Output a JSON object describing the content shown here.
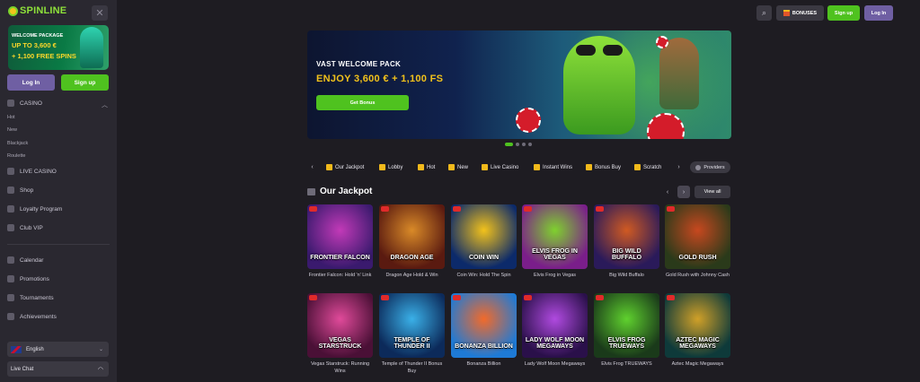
{
  "brand": {
    "logo_text": "SPINLINE"
  },
  "sidebar": {
    "close_icon": "close-icon",
    "promo": {
      "line1": "WELCOME PACKAGE",
      "line2": "UP TO 3,600 €",
      "line3": "+ 1,100 FREE SPINS"
    },
    "login_label": "Log In",
    "signup_label": "Sign up",
    "casino": {
      "label": "CASINO",
      "items": [
        "Hot",
        "New",
        "Blackjack",
        "Roulette"
      ]
    },
    "items": [
      "LIVE CASINO",
      "Shop",
      "Loyalty Program",
      "Club VIP"
    ],
    "items2": [
      "Calendar",
      "Promotions",
      "Tournaments",
      "Achievements"
    ],
    "language": "English",
    "live_chat": "Live Chat"
  },
  "header": {
    "bonuses_label": "BONUSES",
    "signup_label": "Sign up",
    "login_label": "Log In"
  },
  "hero": {
    "title": "VAST WELCOME PACK",
    "subtitle": "ENJOY 3,600 € + 1,100 FS",
    "button": "Get Bonus",
    "slides": 4,
    "active_slide": 1
  },
  "categories": [
    "Our Jackpot",
    "Lobby",
    "Hot",
    "New",
    "Live Casino",
    "Instant Wins",
    "Bonus Buy",
    "Scratch"
  ],
  "providers_label": "Providers",
  "section": {
    "title": "Our Jackpot",
    "view_all": "View all"
  },
  "games": [
    {
      "art": "FRONTIER FALCON",
      "caption": "Frontier Falcon: Hold 'n' Link",
      "c1": "#3a1a6e",
      "c2": "#c23ab8"
    },
    {
      "art": "DRAGON AGE",
      "caption": "Dragon Age Hold & Win",
      "c1": "#5a1a10",
      "c2": "#d98a28"
    },
    {
      "art": "COIN WIN",
      "caption": "Coin Win: Hold The Spin",
      "c1": "#0c2a6a",
      "c2": "#f2c21b"
    },
    {
      "art": "ELVIS FROG IN VEGAS",
      "caption": "Elvis Frog in Vegas",
      "c1": "#7a1e8a",
      "c2": "#7fd12e"
    },
    {
      "art": "BIG WILD BUFFALO",
      "caption": "Big Wild Buffalo",
      "c1": "#2a1a5a",
      "c2": "#d05a22"
    },
    {
      "art": "GOLD RUSH",
      "caption": "Gold Rush with Johnny Cash",
      "c1": "#2a3a1a",
      "c2": "#c7481f"
    },
    {
      "art": "VEGAS STARSTRUCK",
      "caption": "Vegas Starstruck: Running Wins",
      "c1": "#4a1036",
      "c2": "#e04a9a"
    },
    {
      "art": "TEMPLE OF THUNDER II",
      "caption": "Temple of Thunder II Bonus Buy",
      "c1": "#0c2a5a",
      "c2": "#3ab0e8"
    },
    {
      "art": "BONANZA BILLION",
      "caption": "Bonanza Billion",
      "c1": "#1e7ad6",
      "c2": "#f26a2a"
    },
    {
      "art": "LADY WOLF MOON MEGAWAYS",
      "caption": "Lady Wolf Moon Megaways",
      "c1": "#2a104a",
      "c2": "#b04ae0"
    },
    {
      "art": "ELVIS FROG TRUEWAYS",
      "caption": "Elvis Frog TRUEWAYS",
      "c1": "#1a3a1a",
      "c2": "#5fd12e"
    },
    {
      "art": "AZTEC MAGIC MEGAWAYS",
      "caption": "Aztec Magic Megaways",
      "c1": "#0e3a3a",
      "c2": "#d0a028"
    }
  ],
  "colors": {
    "accent_green": "#4fc21f",
    "accent_purple": "#6f5fa3",
    "gold": "#f2c21b",
    "bg": "#1e1c22"
  }
}
